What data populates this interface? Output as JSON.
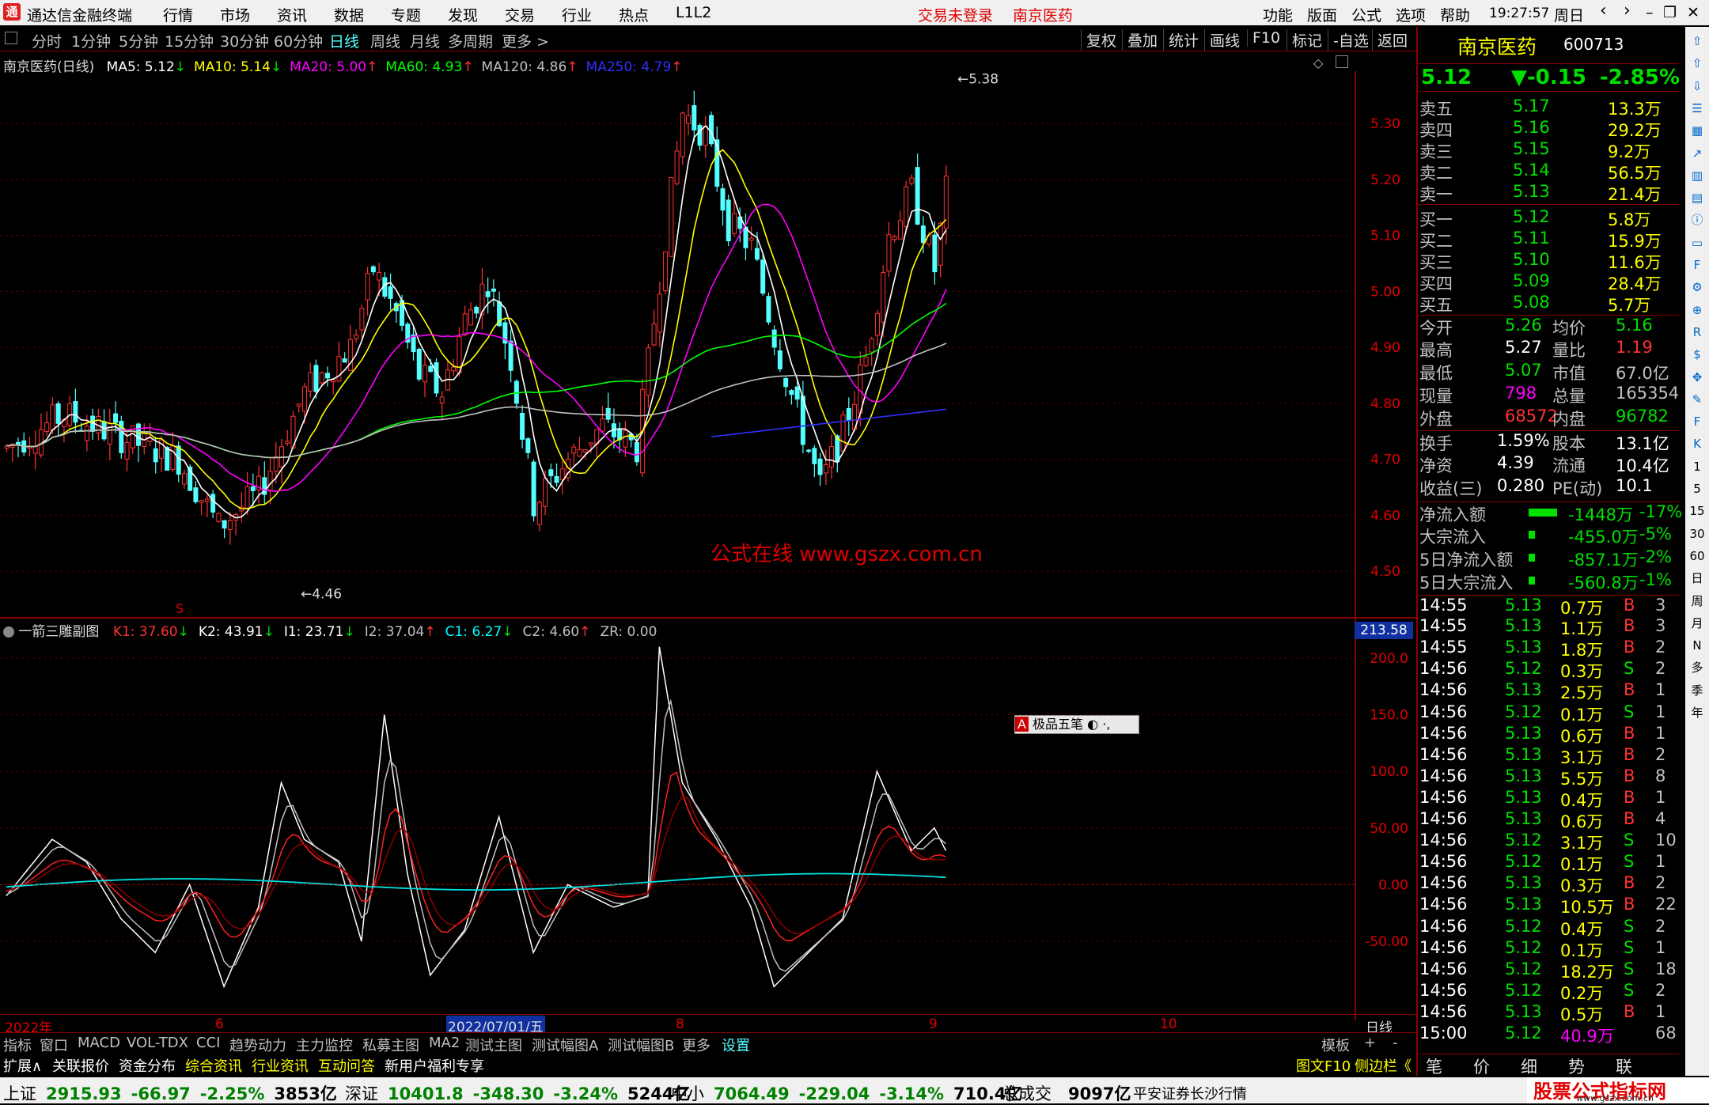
{
  "menubar": {
    "app_title": "通达信金融终端",
    "menus": [
      "行情",
      "市场",
      "资讯",
      "数据",
      "专题",
      "发现",
      "交易",
      "行业",
      "热点",
      "L1L2"
    ],
    "center_status": "交易未登录",
    "center_stock": "南京医药",
    "right_menus": [
      "功能",
      "版面",
      "公式",
      "选项",
      "帮助"
    ],
    "clock": "19:27:57",
    "weekday": "周日"
  },
  "periodbar": {
    "periods": [
      "分时",
      "1分钟",
      "5分钟",
      "15分钟",
      "30分钟",
      "60分钟",
      "日线",
      "周线",
      "月线",
      "多周期",
      "更多 >"
    ],
    "active": "日线",
    "right_buttons": [
      "复权",
      "叠加",
      "统计",
      "画线",
      "F10",
      "标记",
      "-自选",
      "返回"
    ]
  },
  "main_chart": {
    "title": "南京医药(日线)",
    "ma_labels": [
      {
        "text": "MA5: 5.12",
        "arrow": "↓",
        "color": "#ffffff"
      },
      {
        "text": "MA10: 5.14",
        "arrow": "↓",
        "color": "#ffff00"
      },
      {
        "text": "MA20: 5.00",
        "arrow": "↑",
        "color": "#ff00ff"
      },
      {
        "text": "MA60: 4.93",
        "arrow": "↑",
        "color": "#00ff00"
      },
      {
        "text": "MA120: 4.86",
        "arrow": "↑",
        "color": "#c0c0c0"
      },
      {
        "text": "MA250: 4.79",
        "arrow": "↑",
        "color": "#3030ff"
      }
    ],
    "price_ticks": [
      "5.30",
      "5.20",
      "5.10",
      "5.00",
      "4.90",
      "4.80",
      "4.70",
      "4.60",
      "4.50"
    ],
    "high_label": "5.38",
    "low_label": "4.46",
    "watermark": "公式在线  www.gszx.com.cn",
    "s_mark": "S"
  },
  "sub_chart": {
    "title": "一箭三雕副图",
    "labels": [
      {
        "text": "K1: 37.60",
        "arrow": "↓",
        "color": "#ff3232"
      },
      {
        "text": "K2: 43.91",
        "arrow": "↓",
        "color": "#ffffff"
      },
      {
        "text": "I1: 23.71",
        "arrow": "↓",
        "color": "#ffffff"
      },
      {
        "text": "I2: 37.04",
        "arrow": "↑",
        "color": "#c0c0c0"
      },
      {
        "text": "C1: 6.27",
        "arrow": "↓",
        "color": "#00ffff"
      },
      {
        "text": "C2: 4.60",
        "arrow": "↑",
        "color": "#c0c0c0"
      },
      {
        "text": "ZR: 0.00",
        "arrow": "",
        "color": "#c0c0c0"
      }
    ],
    "value_box": "213.58",
    "ticks": [
      "200.0",
      "150.0",
      "100.0",
      "50.00",
      "0.00",
      "-50.00"
    ],
    "popup": "极品五笔"
  },
  "date_axis": {
    "labels": [
      "2022年",
      "6",
      "2022/07/01/五",
      "8",
      "9",
      "10"
    ],
    "period": "日线"
  },
  "quote": {
    "name": "南京医药",
    "code": "600713",
    "price": "5.12",
    "change": "▼-0.15",
    "pct": "-2.85%",
    "asks": [
      {
        "label": "卖五",
        "price": "5.17",
        "vol": "13.3万"
      },
      {
        "label": "卖四",
        "price": "5.16",
        "vol": "29.2万"
      },
      {
        "label": "卖三",
        "price": "5.15",
        "vol": "9.2万"
      },
      {
        "label": "卖二",
        "price": "5.14",
        "vol": "56.5万"
      },
      {
        "label": "卖一",
        "price": "5.13",
        "vol": "21.4万"
      }
    ],
    "bids": [
      {
        "label": "买一",
        "price": "5.12",
        "vol": "5.8万"
      },
      {
        "label": "买二",
        "price": "5.11",
        "vol": "15.9万"
      },
      {
        "label": "买三",
        "price": "5.10",
        "vol": "11.6万"
      },
      {
        "label": "买四",
        "price": "5.09",
        "vol": "28.4万"
      },
      {
        "label": "买五",
        "price": "5.08",
        "vol": "5.7万"
      }
    ],
    "stats": [
      {
        "l1": "今开",
        "v1": "5.26",
        "c1": "#00e000",
        "l2": "均价",
        "v2": "5.16",
        "c2": "#00e000"
      },
      {
        "l1": "最高",
        "v1": "5.27",
        "c1": "#ffffff",
        "l2": "量比",
        "v2": "1.19",
        "c2": "#ff3232"
      },
      {
        "l1": "最低",
        "v1": "5.07",
        "c1": "#00e000",
        "l2": "市值",
        "v2": "67.0亿",
        "c2": "#c0c0c0"
      },
      {
        "l1": "现量",
        "v1": "798",
        "c1": "#ff00ff",
        "l2": "总量",
        "v2": "165354",
        "c2": "#c0c0c0"
      },
      {
        "l1": "外盘",
        "v1": "68572",
        "c1": "#ff3232",
        "l2": "内盘",
        "v2": "96782",
        "c2": "#00e000"
      }
    ],
    "stats2": [
      {
        "l1": "换手",
        "v1": "1.59%",
        "l2": "股本",
        "v2": "13.1亿"
      },
      {
        "l1": "净资",
        "v1": "4.39",
        "l2": "流通",
        "v2": "10.4亿"
      },
      {
        "l1": "收益(三)",
        "v1": "0.280",
        "l2": "PE(动)",
        "v2": "10.1"
      }
    ],
    "flows": [
      {
        "label": "净流入额",
        "val": "-1448万",
        "pct": "-17%",
        "bar": 0.6
      },
      {
        "label": "大宗流入",
        "val": "-455.0万",
        "pct": "-5%",
        "bar": 0.1
      },
      {
        "label": "5日净流入额",
        "val": "-857.1万",
        "pct": "-2%",
        "bar": 0.1
      },
      {
        "label": "5日大宗流入",
        "val": "-560.8万",
        "pct": "-1%",
        "bar": 0.1
      }
    ],
    "ticks": [
      {
        "t": "14:55",
        "p": "5.13",
        "v": "0.7万",
        "bs": "B",
        "n": "3"
      },
      {
        "t": "14:55",
        "p": "5.13",
        "v": "1.1万",
        "bs": "B",
        "n": "3"
      },
      {
        "t": "14:55",
        "p": "5.13",
        "v": "1.8万",
        "bs": "B",
        "n": "2"
      },
      {
        "t": "14:56",
        "p": "5.12",
        "v": "0.3万",
        "bs": "S",
        "n": "2"
      },
      {
        "t": "14:56",
        "p": "5.13",
        "v": "2.5万",
        "bs": "B",
        "n": "1"
      },
      {
        "t": "14:56",
        "p": "5.12",
        "v": "0.1万",
        "bs": "S",
        "n": "1"
      },
      {
        "t": "14:56",
        "p": "5.13",
        "v": "0.6万",
        "bs": "B",
        "n": "1"
      },
      {
        "t": "14:56",
        "p": "5.13",
        "v": "3.1万",
        "bs": "B",
        "n": "2"
      },
      {
        "t": "14:56",
        "p": "5.13",
        "v": "5.5万",
        "bs": "B",
        "n": "8"
      },
      {
        "t": "14:56",
        "p": "5.13",
        "v": "0.4万",
        "bs": "B",
        "n": "1"
      },
      {
        "t": "14:56",
        "p": "5.13",
        "v": "0.6万",
        "bs": "B",
        "n": "4"
      },
      {
        "t": "14:56",
        "p": "5.12",
        "v": "3.1万",
        "bs": "S",
        "n": "10"
      },
      {
        "t": "14:56",
        "p": "5.12",
        "v": "0.1万",
        "bs": "S",
        "n": "1"
      },
      {
        "t": "14:56",
        "p": "5.13",
        "v": "0.3万",
        "bs": "B",
        "n": "2"
      },
      {
        "t": "14:56",
        "p": "5.13",
        "v": "10.5万",
        "bs": "B",
        "n": "22"
      },
      {
        "t": "14:56",
        "p": "5.12",
        "v": "0.4万",
        "bs": "S",
        "n": "2"
      },
      {
        "t": "14:56",
        "p": "5.12",
        "v": "0.1万",
        "bs": "S",
        "n": "1"
      },
      {
        "t": "14:56",
        "p": "5.12",
        "v": "18.2万",
        "bs": "S",
        "n": "18"
      },
      {
        "t": "14:56",
        "p": "5.12",
        "v": "0.2万",
        "bs": "S",
        "n": "2"
      },
      {
        "t": "14:56",
        "p": "5.13",
        "v": "0.5万",
        "bs": "B",
        "n": "1"
      },
      {
        "t": "15:00",
        "p": "5.12",
        "v": "40.9万",
        "bs": "",
        "n": "68"
      }
    ],
    "bottom_tabs": [
      "笔",
      "价",
      "细",
      "势",
      "联"
    ]
  },
  "sidebar_icons": [
    "up-icon",
    "up-icon",
    "down-icon",
    "list-icon",
    "grid-icon",
    "trend-icon",
    "chart-icon",
    "table-icon",
    "info-icon",
    "doc-icon",
    "f10-icon",
    "net-icon",
    "compare-icon",
    "rsi-icon",
    "s-icon",
    "move-icon",
    "pen-icon",
    "fs-icon",
    "k-icon",
    "1",
    "5",
    "15",
    "30",
    "60",
    "日",
    "周",
    "月",
    "N",
    "多",
    "季",
    "年"
  ],
  "tabbar": {
    "tabs": [
      "指标",
      "窗口",
      "MACD",
      "VOL-TDX",
      "CCI",
      "趋势动力",
      "主力监控",
      "私募主图",
      "MA2",
      "测试主图",
      "测试幅图A",
      "测试幅图B",
      "更多",
      "设置"
    ],
    "active": "设置",
    "right": [
      "模板",
      "+",
      "-"
    ]
  },
  "tabbar2": {
    "tabs": [
      "扩展∧",
      "关联报价",
      "资金分布",
      "综合资讯",
      "行业资讯",
      "互动问答",
      "新用户福利专享"
    ],
    "right": [
      "图文F10",
      "侧边栏《"
    ]
  },
  "statusbar": {
    "items": [
      {
        "name": "上证",
        "val": "2915.93",
        "chg": "-66.97",
        "pct": "-2.25%",
        "amt": "3853亿"
      },
      {
        "name": "深证",
        "val": "10401.8",
        "chg": "-348.30",
        "pct": "-3.24%",
        "amt": "5244亿"
      },
      {
        "name": "中小",
        "val": "7064.49",
        "chg": "-229.04",
        "pct": "-3.14%",
        "amt": "710.4亿"
      }
    ],
    "total_label": "总成交",
    "total_val": "9097亿",
    "broker": "平安证券长沙行情",
    "brand": "股票公式指标网",
    "brand_url": "www.gszx.com.cn"
  },
  "colors": {
    "up": "#ff3232",
    "down": "#54ffff",
    "ma5": "#ffffff",
    "ma10": "#ffff00",
    "ma20": "#ff00ff",
    "ma60": "#00ff00",
    "ma120": "#c0c0c0",
    "ma250": "#3030ff"
  }
}
